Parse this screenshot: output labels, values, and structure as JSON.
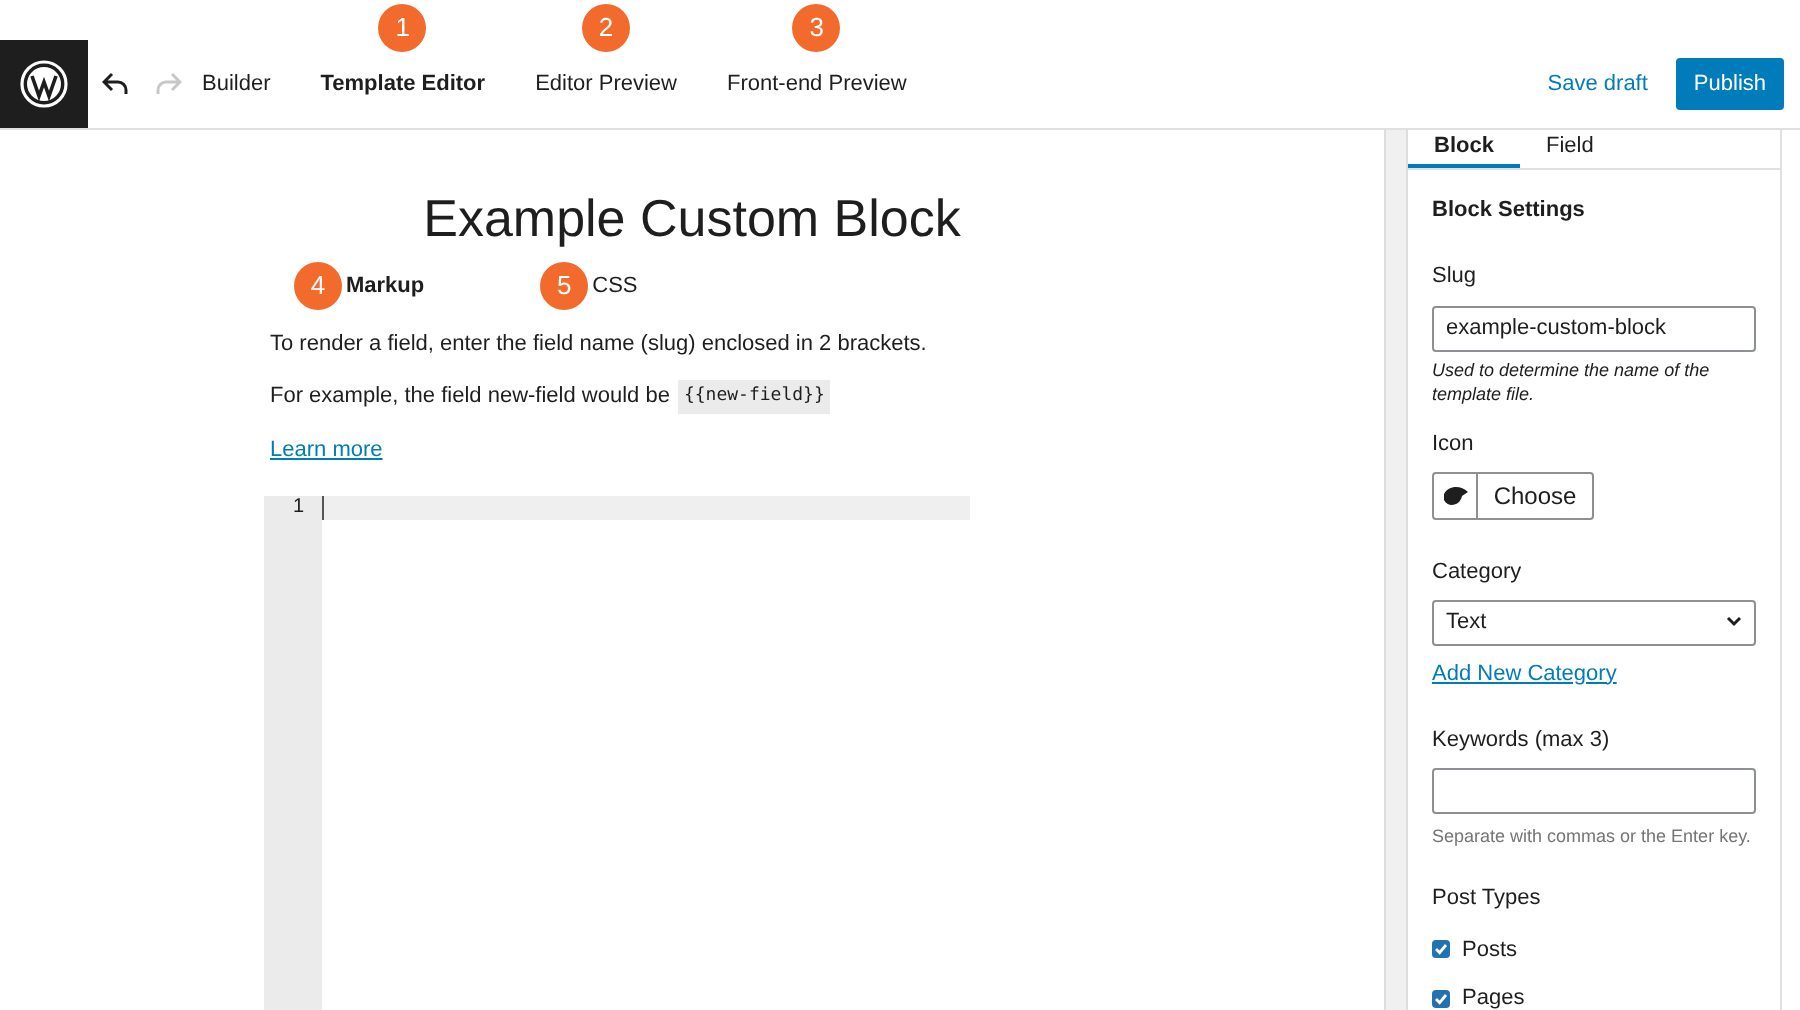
{
  "toolbar": {
    "tabs": [
      {
        "label": "Builder",
        "selected": false
      },
      {
        "label": "Template Editor",
        "selected": true,
        "badge": "1"
      },
      {
        "label": "Editor Preview",
        "selected": false,
        "badge": "2"
      },
      {
        "label": "Front-end Preview",
        "selected": false,
        "badge": "3"
      }
    ],
    "save_draft": "Save draft",
    "publish": "Publish"
  },
  "editor": {
    "title": "Example Custom Block",
    "tabs": [
      {
        "label": "Markup",
        "selected": true,
        "badge": "4"
      },
      {
        "label": "CSS",
        "selected": false,
        "badge": "5"
      }
    ],
    "help": "To render a field, enter the field name (slug) enclosed in 2 brackets.",
    "example": "For example, the field new-field would be",
    "example_code": "{{new-field}}",
    "learn_more": "Learn more",
    "line_numbers": [
      "1"
    ]
  },
  "sidebar": {
    "tabs": [
      {
        "label": "Block",
        "selected": true
      },
      {
        "label": "Field",
        "selected": false
      }
    ],
    "heading": "Block Settings",
    "slug": {
      "label": "Slug",
      "value": "example-custom-block",
      "help": "Used to determine the name of the template file."
    },
    "icon": {
      "label": "Icon",
      "button": "Choose"
    },
    "category": {
      "label": "Category",
      "value": "Text",
      "link": "Add New Category"
    },
    "keywords": {
      "label": "Keywords (max 3)",
      "help": "Separate with commas or the Enter key."
    },
    "post_types": {
      "label": "Post Types",
      "items": [
        {
          "label": "Posts",
          "checked": true
        },
        {
          "label": "Pages",
          "checked": true
        }
      ]
    }
  }
}
